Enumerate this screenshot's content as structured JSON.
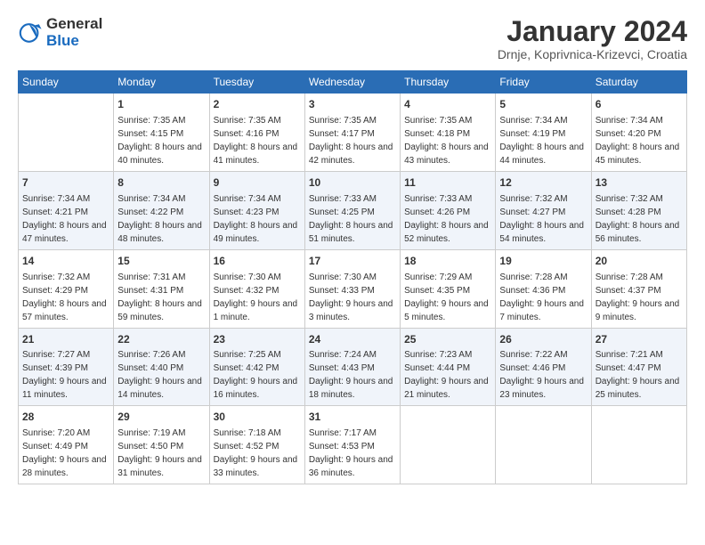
{
  "logo": {
    "general": "General",
    "blue": "Blue"
  },
  "title": "January 2024",
  "subtitle": "Drnje, Koprivnica-Krizevci, Croatia",
  "weekdays": [
    "Sunday",
    "Monday",
    "Tuesday",
    "Wednesday",
    "Thursday",
    "Friday",
    "Saturday"
  ],
  "weeks": [
    [
      {
        "day": "",
        "sunrise": "",
        "sunset": "",
        "daylight": ""
      },
      {
        "day": "1",
        "sunrise": "Sunrise: 7:35 AM",
        "sunset": "Sunset: 4:15 PM",
        "daylight": "Daylight: 8 hours and 40 minutes."
      },
      {
        "day": "2",
        "sunrise": "Sunrise: 7:35 AM",
        "sunset": "Sunset: 4:16 PM",
        "daylight": "Daylight: 8 hours and 41 minutes."
      },
      {
        "day": "3",
        "sunrise": "Sunrise: 7:35 AM",
        "sunset": "Sunset: 4:17 PM",
        "daylight": "Daylight: 8 hours and 42 minutes."
      },
      {
        "day": "4",
        "sunrise": "Sunrise: 7:35 AM",
        "sunset": "Sunset: 4:18 PM",
        "daylight": "Daylight: 8 hours and 43 minutes."
      },
      {
        "day": "5",
        "sunrise": "Sunrise: 7:34 AM",
        "sunset": "Sunset: 4:19 PM",
        "daylight": "Daylight: 8 hours and 44 minutes."
      },
      {
        "day": "6",
        "sunrise": "Sunrise: 7:34 AM",
        "sunset": "Sunset: 4:20 PM",
        "daylight": "Daylight: 8 hours and 45 minutes."
      }
    ],
    [
      {
        "day": "7",
        "sunrise": "Sunrise: 7:34 AM",
        "sunset": "Sunset: 4:21 PM",
        "daylight": "Daylight: 8 hours and 47 minutes."
      },
      {
        "day": "8",
        "sunrise": "Sunrise: 7:34 AM",
        "sunset": "Sunset: 4:22 PM",
        "daylight": "Daylight: 8 hours and 48 minutes."
      },
      {
        "day": "9",
        "sunrise": "Sunrise: 7:34 AM",
        "sunset": "Sunset: 4:23 PM",
        "daylight": "Daylight: 8 hours and 49 minutes."
      },
      {
        "day": "10",
        "sunrise": "Sunrise: 7:33 AM",
        "sunset": "Sunset: 4:25 PM",
        "daylight": "Daylight: 8 hours and 51 minutes."
      },
      {
        "day": "11",
        "sunrise": "Sunrise: 7:33 AM",
        "sunset": "Sunset: 4:26 PM",
        "daylight": "Daylight: 8 hours and 52 minutes."
      },
      {
        "day": "12",
        "sunrise": "Sunrise: 7:32 AM",
        "sunset": "Sunset: 4:27 PM",
        "daylight": "Daylight: 8 hours and 54 minutes."
      },
      {
        "day": "13",
        "sunrise": "Sunrise: 7:32 AM",
        "sunset": "Sunset: 4:28 PM",
        "daylight": "Daylight: 8 hours and 56 minutes."
      }
    ],
    [
      {
        "day": "14",
        "sunrise": "Sunrise: 7:32 AM",
        "sunset": "Sunset: 4:29 PM",
        "daylight": "Daylight: 8 hours and 57 minutes."
      },
      {
        "day": "15",
        "sunrise": "Sunrise: 7:31 AM",
        "sunset": "Sunset: 4:31 PM",
        "daylight": "Daylight: 8 hours and 59 minutes."
      },
      {
        "day": "16",
        "sunrise": "Sunrise: 7:30 AM",
        "sunset": "Sunset: 4:32 PM",
        "daylight": "Daylight: 9 hours and 1 minute."
      },
      {
        "day": "17",
        "sunrise": "Sunrise: 7:30 AM",
        "sunset": "Sunset: 4:33 PM",
        "daylight": "Daylight: 9 hours and 3 minutes."
      },
      {
        "day": "18",
        "sunrise": "Sunrise: 7:29 AM",
        "sunset": "Sunset: 4:35 PM",
        "daylight": "Daylight: 9 hours and 5 minutes."
      },
      {
        "day": "19",
        "sunrise": "Sunrise: 7:28 AM",
        "sunset": "Sunset: 4:36 PM",
        "daylight": "Daylight: 9 hours and 7 minutes."
      },
      {
        "day": "20",
        "sunrise": "Sunrise: 7:28 AM",
        "sunset": "Sunset: 4:37 PM",
        "daylight": "Daylight: 9 hours and 9 minutes."
      }
    ],
    [
      {
        "day": "21",
        "sunrise": "Sunrise: 7:27 AM",
        "sunset": "Sunset: 4:39 PM",
        "daylight": "Daylight: 9 hours and 11 minutes."
      },
      {
        "day": "22",
        "sunrise": "Sunrise: 7:26 AM",
        "sunset": "Sunset: 4:40 PM",
        "daylight": "Daylight: 9 hours and 14 minutes."
      },
      {
        "day": "23",
        "sunrise": "Sunrise: 7:25 AM",
        "sunset": "Sunset: 4:42 PM",
        "daylight": "Daylight: 9 hours and 16 minutes."
      },
      {
        "day": "24",
        "sunrise": "Sunrise: 7:24 AM",
        "sunset": "Sunset: 4:43 PM",
        "daylight": "Daylight: 9 hours and 18 minutes."
      },
      {
        "day": "25",
        "sunrise": "Sunrise: 7:23 AM",
        "sunset": "Sunset: 4:44 PM",
        "daylight": "Daylight: 9 hours and 21 minutes."
      },
      {
        "day": "26",
        "sunrise": "Sunrise: 7:22 AM",
        "sunset": "Sunset: 4:46 PM",
        "daylight": "Daylight: 9 hours and 23 minutes."
      },
      {
        "day": "27",
        "sunrise": "Sunrise: 7:21 AM",
        "sunset": "Sunset: 4:47 PM",
        "daylight": "Daylight: 9 hours and 25 minutes."
      }
    ],
    [
      {
        "day": "28",
        "sunrise": "Sunrise: 7:20 AM",
        "sunset": "Sunset: 4:49 PM",
        "daylight": "Daylight: 9 hours and 28 minutes."
      },
      {
        "day": "29",
        "sunrise": "Sunrise: 7:19 AM",
        "sunset": "Sunset: 4:50 PM",
        "daylight": "Daylight: 9 hours and 31 minutes."
      },
      {
        "day": "30",
        "sunrise": "Sunrise: 7:18 AM",
        "sunset": "Sunset: 4:52 PM",
        "daylight": "Daylight: 9 hours and 33 minutes."
      },
      {
        "day": "31",
        "sunrise": "Sunrise: 7:17 AM",
        "sunset": "Sunset: 4:53 PM",
        "daylight": "Daylight: 9 hours and 36 minutes."
      },
      {
        "day": "",
        "sunrise": "",
        "sunset": "",
        "daylight": ""
      },
      {
        "day": "",
        "sunrise": "",
        "sunset": "",
        "daylight": ""
      },
      {
        "day": "",
        "sunrise": "",
        "sunset": "",
        "daylight": ""
      }
    ]
  ]
}
